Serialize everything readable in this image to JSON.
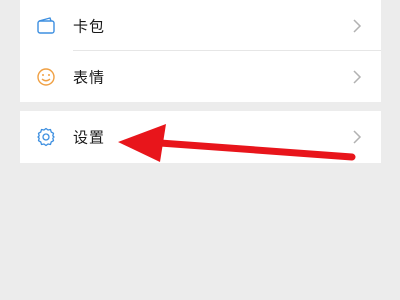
{
  "menu": {
    "items": [
      {
        "label": "卡包",
        "icon": "card-wallet-icon"
      },
      {
        "label": "表情",
        "icon": "smiley-icon"
      },
      {
        "label": "设置",
        "icon": "gear-icon"
      }
    ]
  },
  "colors": {
    "icon_blue": "#3d8fe0",
    "icon_orange": "#f0a043",
    "arrow_red": "#e8151b",
    "page_bg": "#ececec"
  },
  "annotation": {
    "type": "red-arrow",
    "points_to": "设置"
  }
}
